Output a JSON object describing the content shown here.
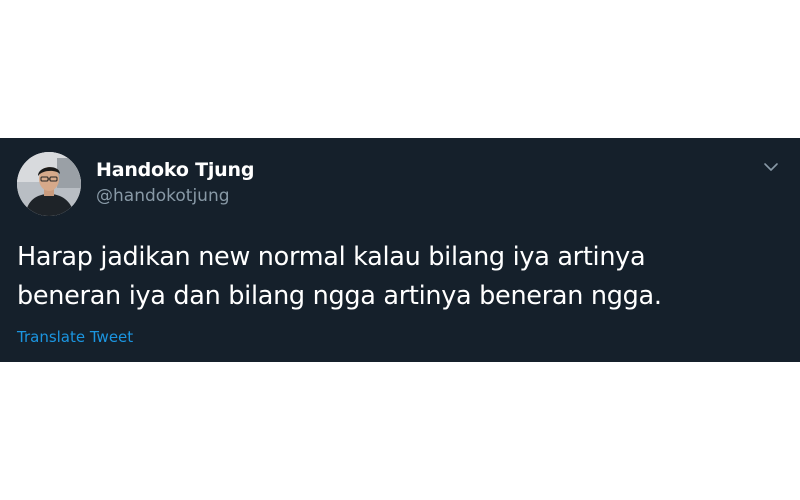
{
  "tweet": {
    "author": {
      "display_name": "Handoko Tjung",
      "handle": "@handokotjung"
    },
    "text_lines": [
      "Harap jadikan new normal kalau bilang iya artinya",
      "beneran iya dan bilang ngga artinya beneran ngga."
    ],
    "translate_label": "Translate Tweet",
    "menu_icon": "chevron-down-icon"
  },
  "colors": {
    "card_background": "#15202b",
    "text_primary": "#ffffff",
    "text_secondary": "#8899a6",
    "link": "#1b95e0"
  }
}
